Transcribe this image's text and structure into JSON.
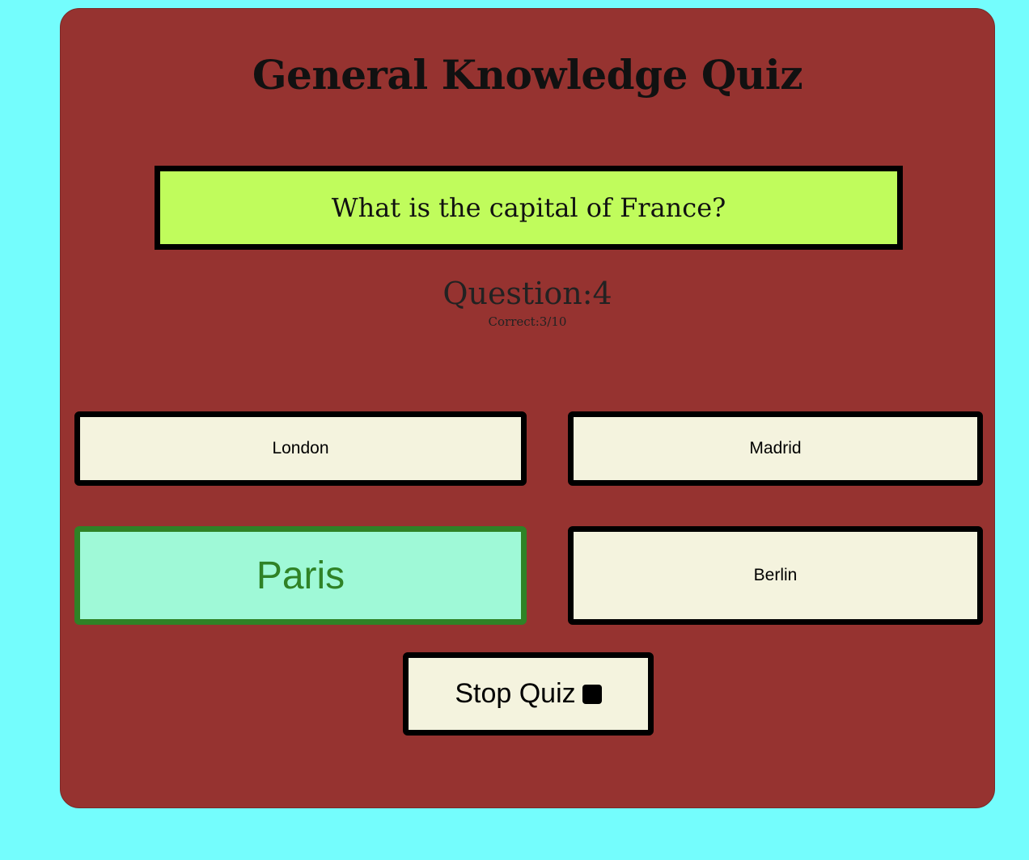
{
  "title": "General Knowledge Quiz",
  "question": {
    "text": "What is the capital of France?",
    "counter": "Question:4",
    "score": "Correct:3/10"
  },
  "answers": [
    {
      "label": "London",
      "state": "default"
    },
    {
      "label": "Madrid",
      "state": "default"
    },
    {
      "label": "Paris",
      "state": "correct"
    },
    {
      "label": "Berlin",
      "state": "default"
    }
  ],
  "stop_button": {
    "label": "Stop Quiz",
    "icon": "stop-icon"
  },
  "colors": {
    "page_background": "#74fdfd",
    "card_background": "#963330",
    "question_background": "#c0fc5c",
    "answer_background": "#f4f3de",
    "correct_background": "#9ff9d7",
    "correct_accent": "#2f8226"
  }
}
